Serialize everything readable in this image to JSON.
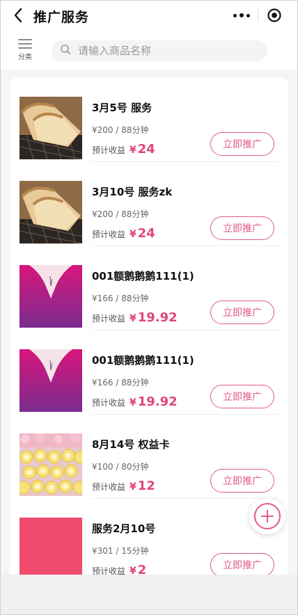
{
  "header": {
    "title": "推广服务"
  },
  "search": {
    "category_label": "分类",
    "placeholder": "请输入商品名称"
  },
  "items": [
    {
      "name": "3月5号 服务",
      "price": "¥200 / 88分钟",
      "earn_label": "预计收益",
      "currency": "¥",
      "earn": "24",
      "button": "立即推广",
      "thumb": "bread"
    },
    {
      "name": "3月10号 服务zk",
      "price": "¥200 / 88分钟",
      "earn_label": "预计收益",
      "currency": "¥",
      "earn": "24",
      "button": "立即推广",
      "thumb": "bread"
    },
    {
      "name": "001额鹅鹅鹅111(1)",
      "price": "¥166 / 88分钟",
      "earn_label": "预计收益",
      "currency": "¥",
      "earn": "19.92",
      "button": "立即推广",
      "thumb": "magenta-graphic"
    },
    {
      "name": "001额鹅鹅鹅111(1)",
      "price": "¥166 / 88分钟",
      "earn_label": "预计收益",
      "currency": "¥",
      "earn": "19.92",
      "button": "立即推广",
      "thumb": "magenta-graphic"
    },
    {
      "name": "8月14号 权益卡",
      "price": "¥100 / 80分钟",
      "earn_label": "预计收益",
      "currency": "¥",
      "earn": "12",
      "button": "立即推广",
      "thumb": "lemon-cakes"
    },
    {
      "name": "服务2月10号",
      "price": "¥301 / 15分钟",
      "earn_label": "预计收益",
      "currency": "¥",
      "earn": "2",
      "button": "立即推广",
      "thumb": "pink-square"
    }
  ],
  "colors": {
    "accent": "#e05a89",
    "price_accent": "#e0457b",
    "magenta": "#d81b7a",
    "pink": "#f04a6c"
  }
}
